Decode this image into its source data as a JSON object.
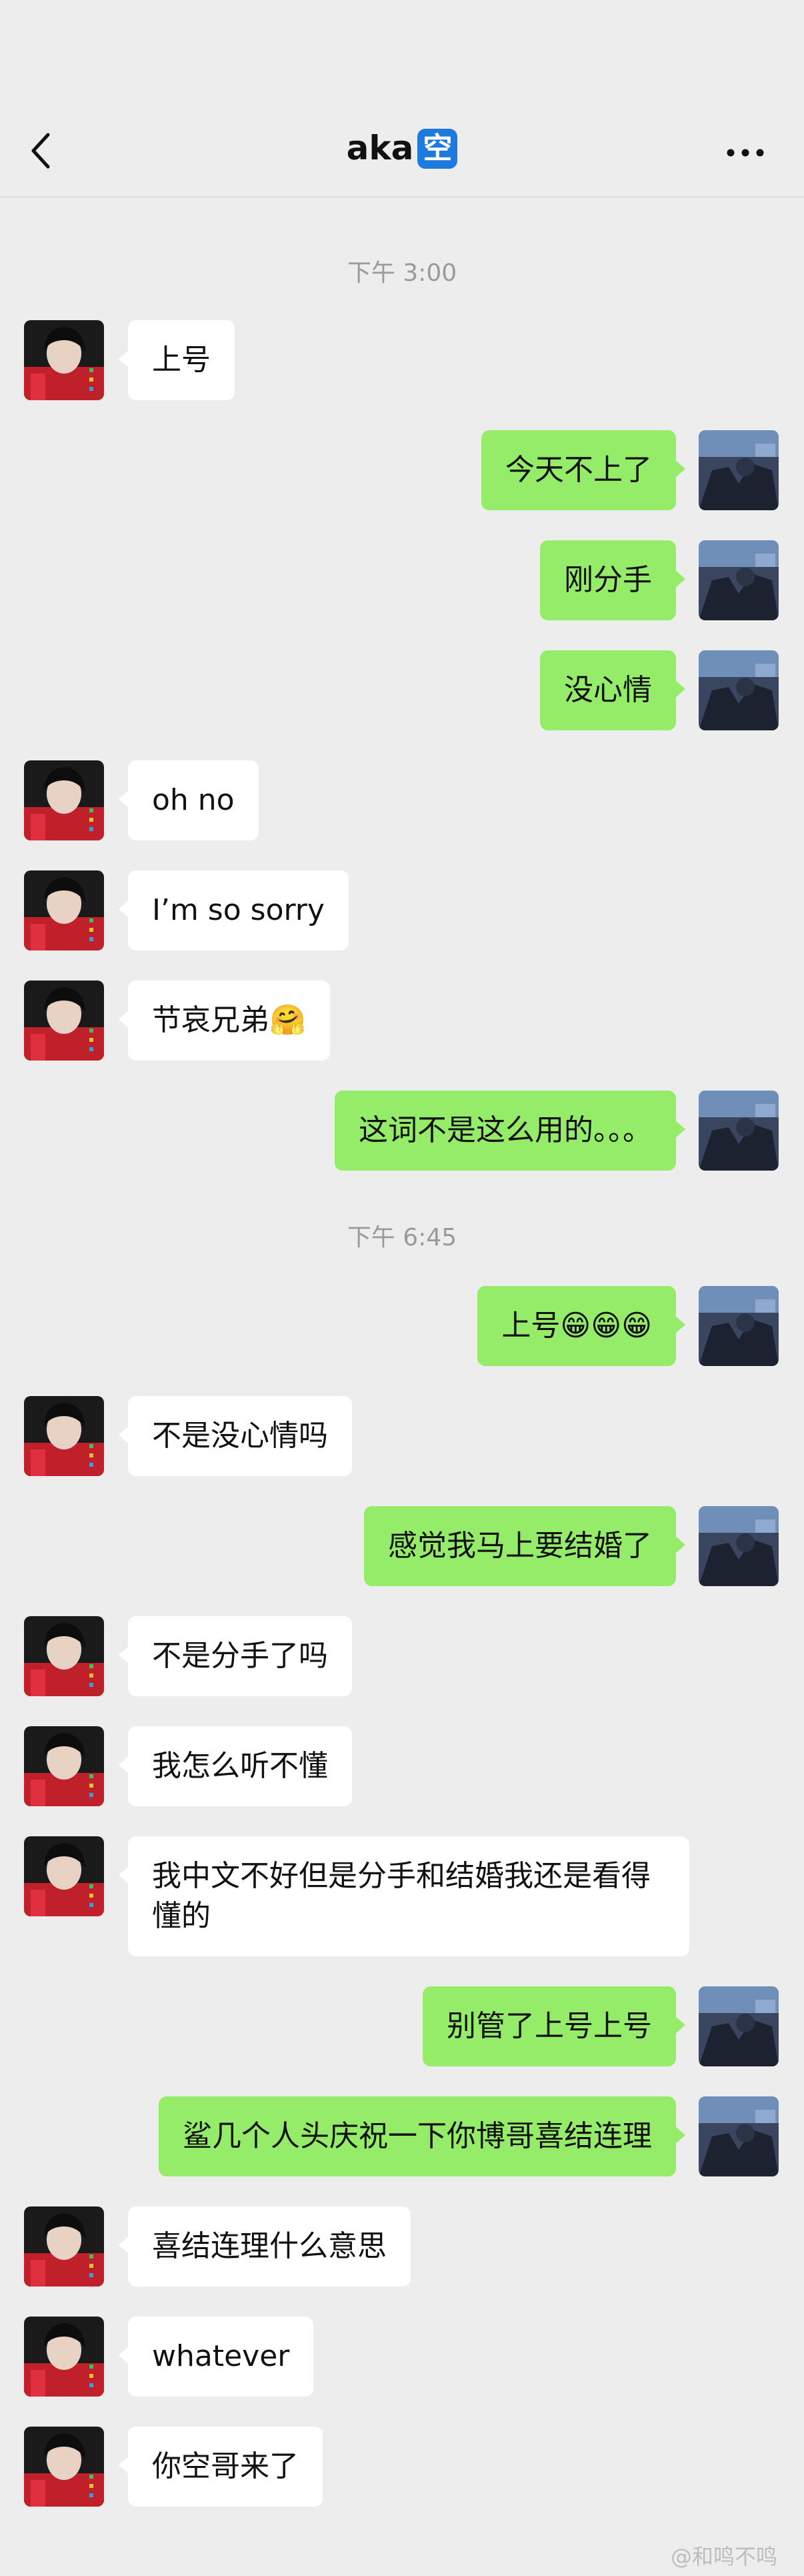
{
  "header": {
    "title": "aka",
    "title_badge": "空",
    "back_icon": "chevron-left-icon",
    "more_icon": "more-dots-icon"
  },
  "timestamps": [
    "下午 3:00",
    "下午 6:45"
  ],
  "messages": [
    {
      "from": "other",
      "text": "上号"
    },
    {
      "from": "me",
      "text": "今天不上了"
    },
    {
      "from": "me",
      "text": "刚分手"
    },
    {
      "from": "me",
      "text": "没心情"
    },
    {
      "from": "other",
      "text": "oh no"
    },
    {
      "from": "other",
      "text": "I’m so sorry"
    },
    {
      "from": "other",
      "text": "节哀兄弟🤗"
    },
    {
      "from": "me",
      "text": "这词不是这么用的。。。"
    },
    {
      "from": "me",
      "text": "上号😁😁😁"
    },
    {
      "from": "other",
      "text": "不是没心情吗"
    },
    {
      "from": "me",
      "text": "感觉我马上要结婚了"
    },
    {
      "from": "other",
      "text": "不是分手了吗"
    },
    {
      "from": "other",
      "text": "我怎么听不懂"
    },
    {
      "from": "other",
      "text": "我中文不好但是分手和结婚我还是看得懂的"
    },
    {
      "from": "me",
      "text": "别管了上号上号"
    },
    {
      "from": "me",
      "text": "鲨几个人头庆祝一下你博哥喜结连理"
    },
    {
      "from": "other",
      "text": "喜结连理什么意思"
    },
    {
      "from": "other",
      "text": "whatever"
    },
    {
      "from": "other",
      "text": "你空哥来了"
    }
  ],
  "watermark": "@和鸣不鸣",
  "colors": {
    "background": "#ededed",
    "my_bubble": "#95ec69",
    "other_bubble": "#ffffff",
    "badge": "#1f7ae0"
  }
}
